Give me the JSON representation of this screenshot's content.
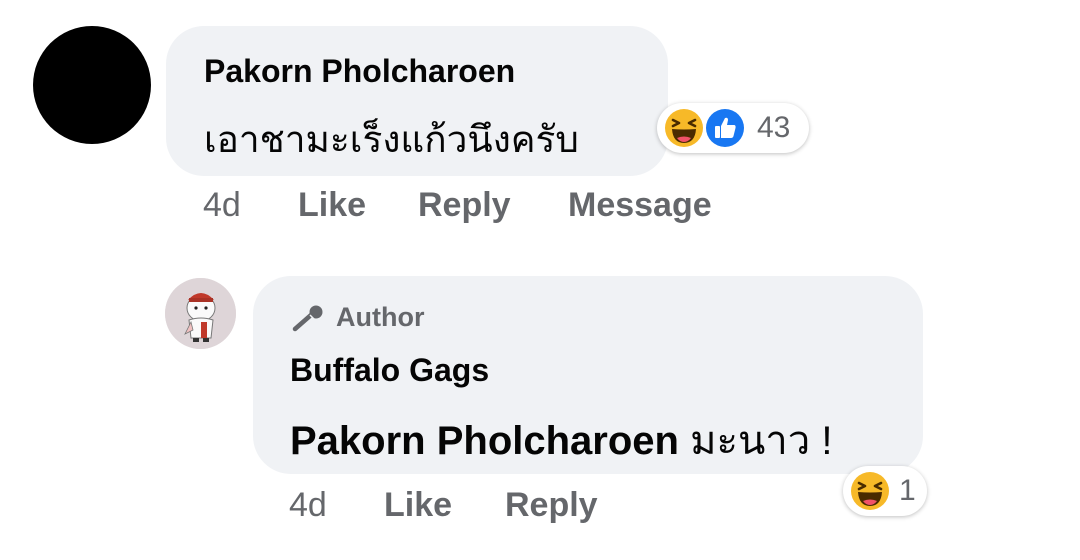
{
  "comment": {
    "author": "Pakorn Pholcharoen",
    "text": "เอาชามะเร็งแก้วนึงครับ",
    "reactions": {
      "icons": [
        "haha-icon",
        "like-icon"
      ],
      "count": "43"
    },
    "time": "4d",
    "actions": {
      "like": "Like",
      "reply": "Reply",
      "message": "Message"
    }
  },
  "reply": {
    "badge": "Author",
    "author": "Buffalo Gags",
    "mention": "Pakorn Pholcharoen",
    "text": " มะนาว !",
    "reactions": {
      "icons": [
        "haha-icon"
      ],
      "count": "1"
    },
    "time": "4d",
    "actions": {
      "like": "Like",
      "reply": "Reply"
    }
  },
  "colors": {
    "bubble": "#f0f2f5",
    "secondary_text": "#65676b",
    "like_blue": "#1877f2",
    "haha_yellow": "#f7b928"
  }
}
